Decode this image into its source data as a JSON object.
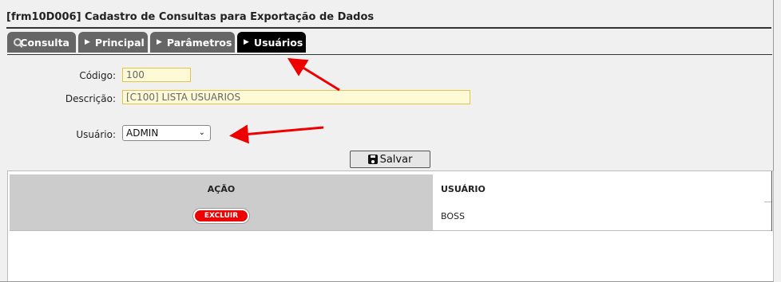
{
  "window": {
    "title": "[frm10D006] Cadastro de Consultas para Exportação de Dados"
  },
  "tabs": [
    {
      "label": "Consulta",
      "icon": "search-icon"
    },
    {
      "label": "Principal",
      "icon": "caret-right-icon"
    },
    {
      "label": "Parâmetros",
      "icon": "caret-right-icon"
    },
    {
      "label": "Usuários",
      "icon": "caret-right-icon",
      "active": true
    }
  ],
  "form": {
    "codigo_label": "Código:",
    "codigo_value": "100",
    "descricao_label": "Descrição:",
    "descricao_value": "[C100] LISTA USUARIOS",
    "usuario_label": "Usuário:",
    "usuario_value": "ADMIN",
    "save_label": "Salvar"
  },
  "grid": {
    "headers": [
      "AÇÃO",
      "USUÁRIO"
    ],
    "rows": [
      {
        "action": "EXCLUIR",
        "user": "BOSS"
      }
    ]
  },
  "colors": {
    "active_tab": "#000000",
    "tab": "#666666",
    "field_bg": "#fffad6",
    "delete": "#e00000",
    "arrow": "#e00000"
  }
}
